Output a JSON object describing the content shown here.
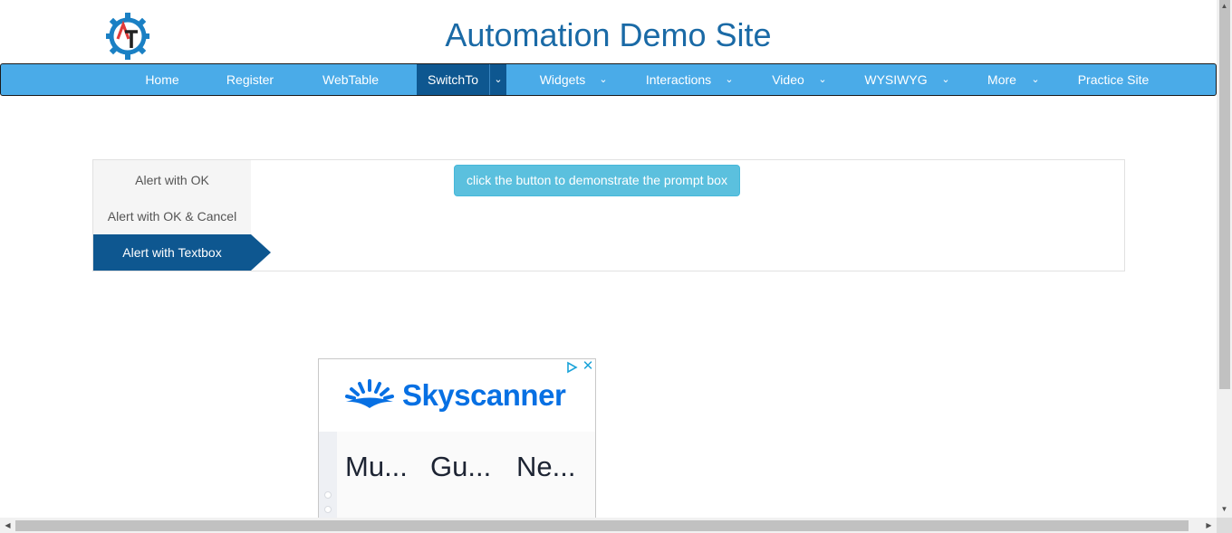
{
  "header": {
    "title": "Automation Demo Site",
    "logo_icon": "automation-gear-logo",
    "colors": {
      "title": "#1a6aa6",
      "gear": "#1a80c4",
      "accent": "#e03a3a"
    }
  },
  "nav": {
    "items": [
      {
        "label": "Home"
      },
      {
        "label": "Register"
      },
      {
        "label": "WebTable"
      },
      {
        "label": "SwitchTo",
        "active": true,
        "dropdown": true
      },
      {
        "label": "Widgets",
        "dropdown": true
      },
      {
        "label": "Interactions",
        "dropdown": true
      },
      {
        "label": "Video",
        "dropdown": true
      },
      {
        "label": "WYSIWYG",
        "dropdown": true
      },
      {
        "label": "More",
        "dropdown": true
      },
      {
        "label": "Practice Site"
      }
    ],
    "colors": {
      "bar": "#4aabe8",
      "active": "#0e5790"
    },
    "dropdown_icon": "chevron-down-icon"
  },
  "alerts": {
    "tabs": [
      {
        "label": "Alert with OK"
      },
      {
        "label": "Alert with OK & Cancel"
      },
      {
        "label": "Alert with Textbox",
        "active": true
      }
    ],
    "button_label": "click the button to demonstrate the prompt box",
    "colors": {
      "button": "#5bc0de",
      "active_tab": "#0e5790"
    }
  },
  "ad": {
    "brand": "Skyscanner",
    "adchoices_icon": "adchoices-icon",
    "close_icon": "close-icon",
    "destinations": [
      "Mu...",
      "Gu...",
      "Ne..."
    ],
    "colors": {
      "brand": "#0770e3"
    }
  }
}
